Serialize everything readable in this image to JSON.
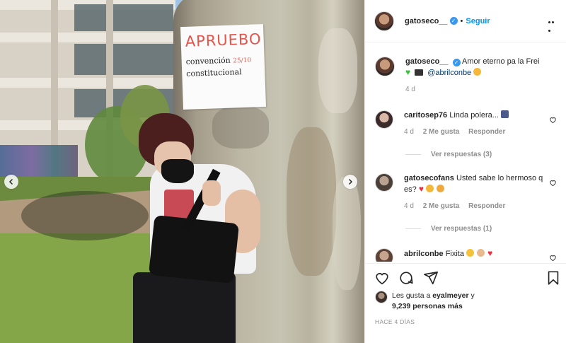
{
  "photo": {
    "sign_line1": "APRUEBO",
    "sign_line2": "convención",
    "sign_date": "25/10",
    "sign_line3": "constitucional"
  },
  "header": {
    "username": "gatoseco__",
    "follow_label": "Seguir",
    "verified_symbol": "✓",
    "separator": "•"
  },
  "caption": {
    "username": "gatoseco__",
    "text": "Amor eterno pa la Frei",
    "mention": "@abrilconbe",
    "time": "4 d"
  },
  "comments": [
    {
      "username": "caritosep76",
      "text": "Linda polera...",
      "time": "4 d",
      "likes": "2 Me gusta",
      "reply": "Responder",
      "replies": "Ver respuestas (3)"
    },
    {
      "username": "gatosecofans",
      "text": "Usted sabe lo hermoso q es?",
      "time": "4 d",
      "likes": "2 Me gusta",
      "reply": "Responder",
      "replies": "Ver respuestas (1)"
    },
    {
      "username": "abrilconbe",
      "text": "Fixita"
    }
  ],
  "likes": {
    "prefix": "Les gusta a",
    "user": "eyalmeyer",
    "suffix": "y",
    "count": "9,239 personas más"
  },
  "posted": "HACE 4 DÍAS",
  "icons": [
    "chevron-left-icon",
    "chevron-right-icon",
    "verified-icon",
    "more-icon",
    "heart-icon",
    "comment-icon",
    "share-icon",
    "bookmark-icon"
  ],
  "colors": {
    "accent": "#0095f6",
    "verified": "#3897f0",
    "muted": "#8e8e8e",
    "text": "#262626"
  }
}
